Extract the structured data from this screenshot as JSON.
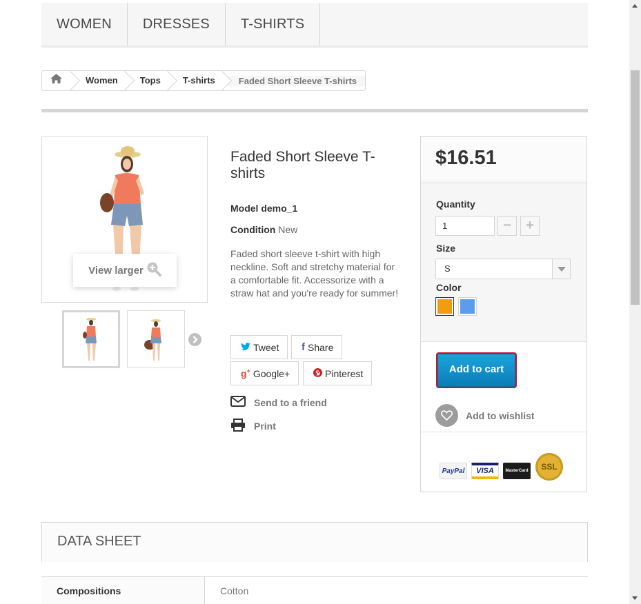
{
  "nav": {
    "items": [
      {
        "label": "WOMEN"
      },
      {
        "label": "DRESSES"
      },
      {
        "label": "T-SHIRTS"
      }
    ]
  },
  "breadcrumb": {
    "home_icon": "home-icon",
    "items": [
      {
        "label": "Women"
      },
      {
        "label": "Tops"
      },
      {
        "label": "T-shirts"
      }
    ],
    "current": "Faded Short Sleeve T-shirts"
  },
  "gallery": {
    "view_larger": "View larger",
    "zoom_icon": "zoom-in-icon",
    "next_icon": "chevron-right-icon"
  },
  "product": {
    "title": "Faded Short Sleeve T-shirts",
    "model_label": "Model",
    "model_value": "demo_1",
    "condition_label": "Condition",
    "condition_value": "New",
    "description": "Faded short sleeve t-shirt with high neckline. Soft and stretchy material for a comfortable fit. Accessorize with a straw hat and you're ready for summer!"
  },
  "social": {
    "tweet": "Tweet",
    "share": "Share",
    "googleplus": "Google+",
    "pinterest": "Pinterest"
  },
  "links": {
    "send_friend": "Send to a friend",
    "print": "Print"
  },
  "buy": {
    "price": "$16.51",
    "quantity_label": "Quantity",
    "quantity_value": "1",
    "size_label": "Size",
    "size_value": "S",
    "color_label": "Color",
    "colors": [
      "#f39c11",
      "#5d9cec"
    ],
    "add_to_cart": "Add to cart",
    "add_to_wishlist": "Add to wishlist"
  },
  "payment": {
    "paypal": "PayPal",
    "visa": "VISA",
    "mastercard": "MasterCard",
    "ssl": "SSL"
  },
  "datasheet": {
    "heading": "DATA SHEET",
    "rows": [
      {
        "name": "Compositions",
        "value": "Cotton"
      }
    ]
  }
}
